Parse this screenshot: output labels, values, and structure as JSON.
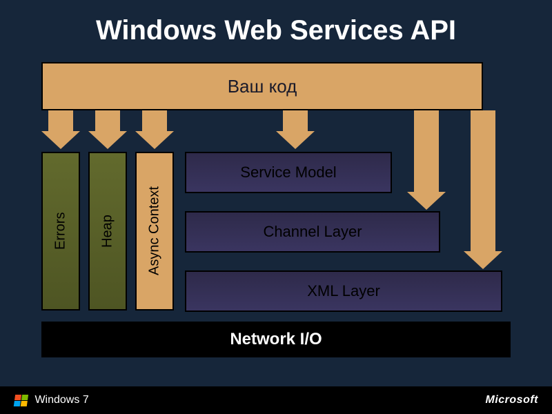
{
  "title": "Windows Web Services API",
  "usercode": "Ваш код",
  "pillars": [
    "Errors",
    "Heap",
    "Async  Context"
  ],
  "layers": [
    "Service Model",
    "Channel Layer",
    "XML Layer"
  ],
  "network": "Network I/O",
  "footer": {
    "windows": "Windows",
    "winver": "7",
    "microsoft": "Microsoft"
  }
}
